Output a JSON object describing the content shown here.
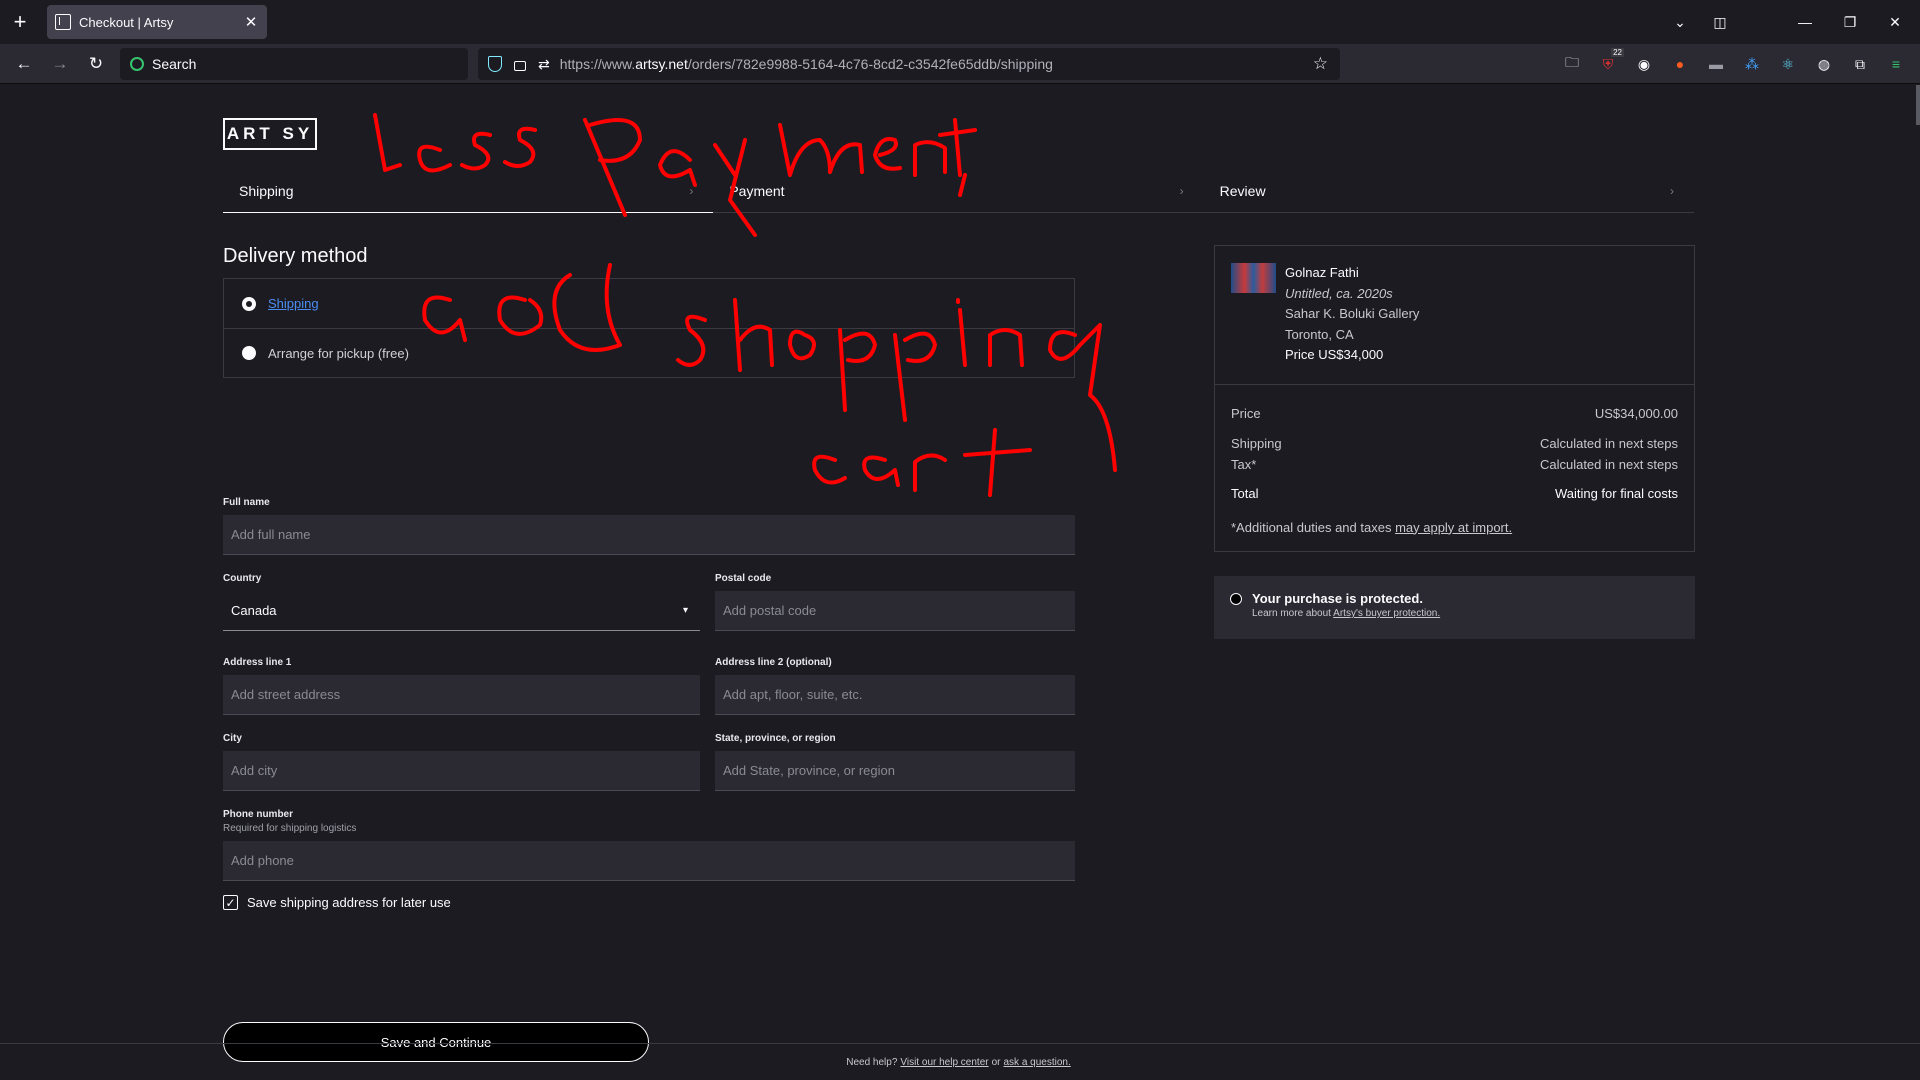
{
  "browser": {
    "tab_title": "Checkout | Artsy",
    "search_placeholder": "Search",
    "url_prefix": "https://www.",
    "url_domain": "artsy.net",
    "url_path": "/orders/782e9988-5164-4c76-8cd2-c3542fe65ddb/shipping",
    "extension_badge": "22"
  },
  "logo": "ART SY",
  "steps": [
    "Shipping",
    "Payment",
    "Review"
  ],
  "delivery": {
    "title": "Delivery method",
    "options": [
      "Shipping",
      "Arrange for pickup (free)"
    ]
  },
  "form": {
    "full_name": {
      "label": "Full name",
      "placeholder": "Add full name"
    },
    "country": {
      "label": "Country",
      "value": "Canada"
    },
    "postal_code": {
      "label": "Postal code",
      "placeholder": "Add postal code"
    },
    "address1": {
      "label": "Address line 1",
      "placeholder": "Add street address"
    },
    "address2": {
      "label": "Address line 2 (optional)",
      "placeholder": "Add apt, floor, suite, etc."
    },
    "city": {
      "label": "City",
      "placeholder": "Add city"
    },
    "region": {
      "label": "State, province, or region",
      "placeholder": "Add State, province, or region"
    },
    "phone": {
      "label": "Phone number",
      "sub": "Required for shipping logistics",
      "placeholder": "Add phone"
    },
    "save_address": "Save shipping address for later use",
    "submit": "Save and Continue"
  },
  "summary": {
    "artist": "Golnaz Fathi",
    "title": "Untitled, ca. 2020s",
    "gallery": "Sahar K. Boluki Gallery",
    "location": "Toronto, CA",
    "price_line": "Price US$34,000",
    "rows": [
      {
        "label": "Price",
        "value": "US$34,000.00"
      },
      {
        "label": "Shipping",
        "value": "Calculated in next steps"
      },
      {
        "label": "Tax*",
        "value": "Calculated in next steps"
      }
    ],
    "total": {
      "label": "Total",
      "value": "Waiting for final costs"
    },
    "duties_text": "*Additional duties and taxes ",
    "duties_link": "may apply at import."
  },
  "protection": {
    "title": "Your purchase is protected.",
    "text": "Learn more about ",
    "link": "Artsy's buyer protection."
  },
  "footer": {
    "text": "Need help?",
    "link1": "Visit our help center",
    "or": "or",
    "link2": "ask a question."
  },
  "colors": {
    "annotation": "#ff0000",
    "link": "#4a8df0",
    "background": "#1c1b22"
  }
}
